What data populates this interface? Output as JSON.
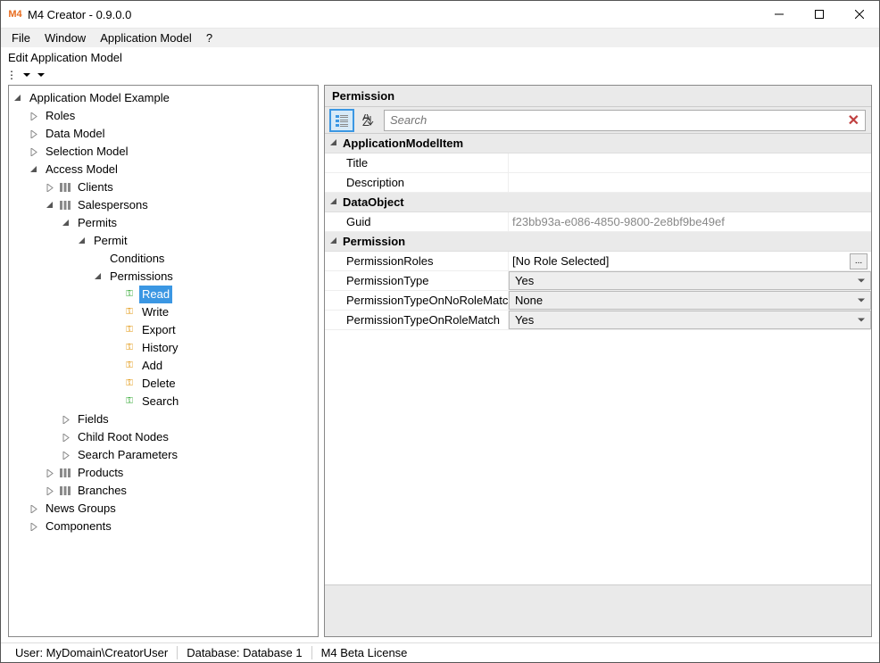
{
  "window": {
    "title": "M4 Creator - 0.9.0.0",
    "logo_text": "M4",
    "logo_color": "#e86c1f"
  },
  "menubar": [
    "File",
    "Window",
    "Application Model",
    "?"
  ],
  "subheader": "Edit Application Model",
  "tree": {
    "root": "Application Model Example",
    "roles": "Roles",
    "data_model": "Data Model",
    "selection_model": "Selection Model",
    "access_model": "Access Model",
    "clients": "Clients",
    "salespersons": "Salespersons",
    "permits": "Permits",
    "permit": "Permit",
    "conditions": "Conditions",
    "permissions": "Permissions",
    "read": "Read",
    "write": "Write",
    "export": "Export",
    "history": "History",
    "add": "Add",
    "delete": "Delete",
    "search": "Search",
    "fields": "Fields",
    "child_root_nodes": "Child Root Nodes",
    "search_params": "Search Parameters",
    "products": "Products",
    "branches": "Branches",
    "news_groups": "News Groups",
    "components": "Components"
  },
  "props": {
    "panel_title": "Permission",
    "search_placeholder": "Search",
    "cat_app_item": "ApplicationModelItem",
    "title_label": "Title",
    "title_value": "",
    "desc_label": "Description",
    "desc_value": "",
    "cat_dataobject": "DataObject",
    "guid_label": "Guid",
    "guid_value": "f23bb93a-e086-4850-9800-2e8bf9be49ef",
    "cat_permission": "Permission",
    "roles_label": "PermissionRoles",
    "roles_value": "[No Role Selected]",
    "type_label": "PermissionType",
    "type_value": "Yes",
    "no_role_label": "PermissionTypeOnNoRoleMatch",
    "no_role_value": "None",
    "role_match_label": "PermissionTypeOnRoleMatch",
    "role_match_value": "Yes"
  },
  "statusbar": {
    "user": "User: MyDomain\\CreatorUser",
    "database": "Database: Database 1",
    "license": "M4 Beta License"
  }
}
